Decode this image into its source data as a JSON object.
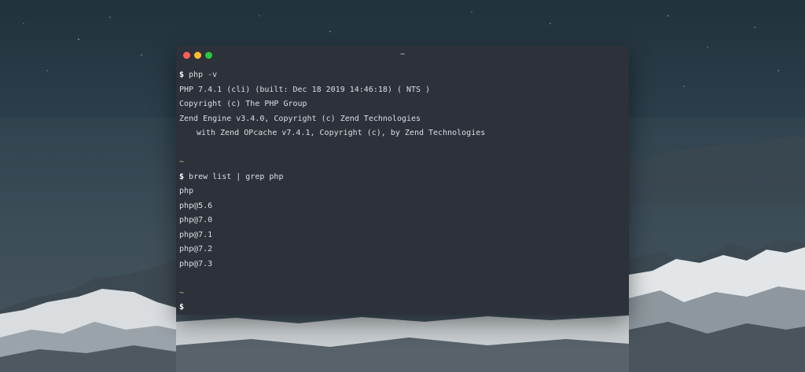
{
  "window": {
    "title": "~",
    "buttons": [
      "close",
      "minimize",
      "maximize"
    ]
  },
  "terminal": {
    "prompt_symbol": "$",
    "lines": [
      {
        "type": "command",
        "text": "php -v"
      },
      {
        "type": "output",
        "text": "PHP 7.4.1 (cli) (built: Dec 18 2019 14:46:18) ( NTS )"
      },
      {
        "type": "output",
        "text": "Copyright (c) The PHP Group"
      },
      {
        "type": "output",
        "text": "Zend Engine v3.4.0, Copyright (c) Zend Technologies"
      },
      {
        "type": "output-indent",
        "text": "with Zend OPcache v7.4.1, Copyright (c), by Zend Technologies"
      },
      {
        "type": "blank",
        "text": ""
      },
      {
        "type": "cwd",
        "text": "~"
      },
      {
        "type": "command",
        "text": "brew list | grep php"
      },
      {
        "type": "output",
        "text": "php"
      },
      {
        "type": "output",
        "text": "php@5.6"
      },
      {
        "type": "output",
        "text": "php@7.0"
      },
      {
        "type": "output",
        "text": "php@7.1"
      },
      {
        "type": "output",
        "text": "php@7.2"
      },
      {
        "type": "output",
        "text": "php@7.3"
      },
      {
        "type": "blank",
        "text": ""
      },
      {
        "type": "cwd",
        "text": "~"
      },
      {
        "type": "command",
        "text": ""
      }
    ]
  },
  "colors": {
    "terminal_bg": "#2c313a",
    "text": "#dcdfe4",
    "cwd": "#e5c07b",
    "close": "#ff5f57",
    "minimize": "#febc2e",
    "maximize": "#28c840"
  }
}
